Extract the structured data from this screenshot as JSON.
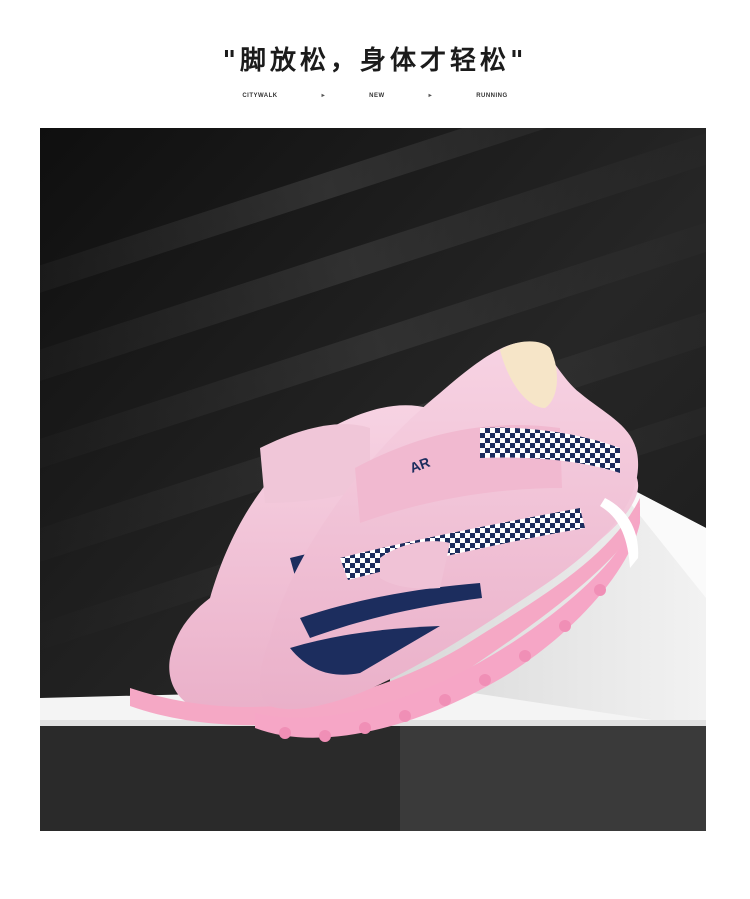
{
  "headline": "\"脚放松，身体才轻松\"",
  "tagline": {
    "items": [
      "CITYWALK",
      "NEW",
      "RUNNING"
    ],
    "separator": "▸"
  },
  "product_image": {
    "colors": {
      "upper": "#f3bfd6",
      "accent": "#1c2d5e",
      "sole": "#f6a6c6",
      "background_dark": "#151515",
      "pedestal": "#e9e9e9"
    }
  }
}
